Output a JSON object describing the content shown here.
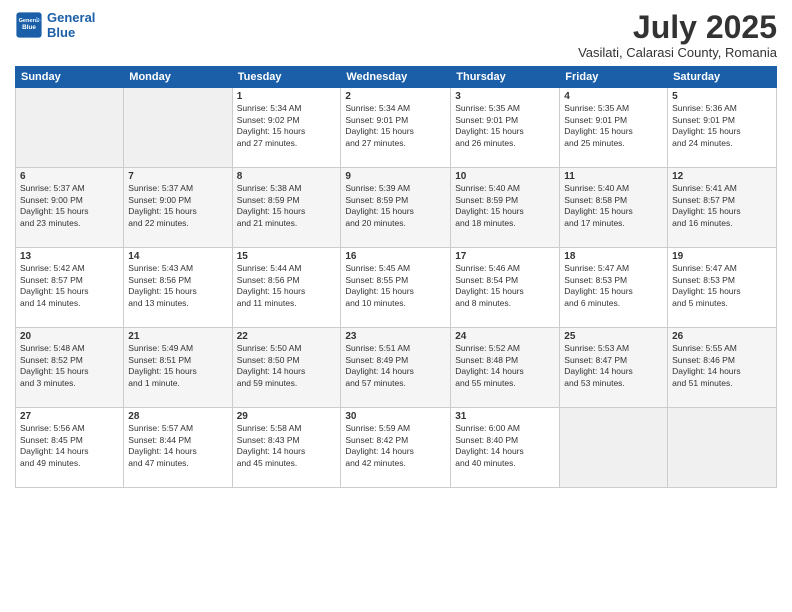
{
  "header": {
    "logo_line1": "General",
    "logo_line2": "Blue",
    "month_year": "July 2025",
    "location": "Vasilati, Calarasi County, Romania"
  },
  "weekdays": [
    "Sunday",
    "Monday",
    "Tuesday",
    "Wednesday",
    "Thursday",
    "Friday",
    "Saturday"
  ],
  "weeks": [
    [
      {
        "day": "",
        "info": ""
      },
      {
        "day": "",
        "info": ""
      },
      {
        "day": "1",
        "info": "Sunrise: 5:34 AM\nSunset: 9:02 PM\nDaylight: 15 hours\nand 27 minutes."
      },
      {
        "day": "2",
        "info": "Sunrise: 5:34 AM\nSunset: 9:01 PM\nDaylight: 15 hours\nand 27 minutes."
      },
      {
        "day": "3",
        "info": "Sunrise: 5:35 AM\nSunset: 9:01 PM\nDaylight: 15 hours\nand 26 minutes."
      },
      {
        "day": "4",
        "info": "Sunrise: 5:35 AM\nSunset: 9:01 PM\nDaylight: 15 hours\nand 25 minutes."
      },
      {
        "day": "5",
        "info": "Sunrise: 5:36 AM\nSunset: 9:01 PM\nDaylight: 15 hours\nand 24 minutes."
      }
    ],
    [
      {
        "day": "6",
        "info": "Sunrise: 5:37 AM\nSunset: 9:00 PM\nDaylight: 15 hours\nand 23 minutes."
      },
      {
        "day": "7",
        "info": "Sunrise: 5:37 AM\nSunset: 9:00 PM\nDaylight: 15 hours\nand 22 minutes."
      },
      {
        "day": "8",
        "info": "Sunrise: 5:38 AM\nSunset: 8:59 PM\nDaylight: 15 hours\nand 21 minutes."
      },
      {
        "day": "9",
        "info": "Sunrise: 5:39 AM\nSunset: 8:59 PM\nDaylight: 15 hours\nand 20 minutes."
      },
      {
        "day": "10",
        "info": "Sunrise: 5:40 AM\nSunset: 8:59 PM\nDaylight: 15 hours\nand 18 minutes."
      },
      {
        "day": "11",
        "info": "Sunrise: 5:40 AM\nSunset: 8:58 PM\nDaylight: 15 hours\nand 17 minutes."
      },
      {
        "day": "12",
        "info": "Sunrise: 5:41 AM\nSunset: 8:57 PM\nDaylight: 15 hours\nand 16 minutes."
      }
    ],
    [
      {
        "day": "13",
        "info": "Sunrise: 5:42 AM\nSunset: 8:57 PM\nDaylight: 15 hours\nand 14 minutes."
      },
      {
        "day": "14",
        "info": "Sunrise: 5:43 AM\nSunset: 8:56 PM\nDaylight: 15 hours\nand 13 minutes."
      },
      {
        "day": "15",
        "info": "Sunrise: 5:44 AM\nSunset: 8:56 PM\nDaylight: 15 hours\nand 11 minutes."
      },
      {
        "day": "16",
        "info": "Sunrise: 5:45 AM\nSunset: 8:55 PM\nDaylight: 15 hours\nand 10 minutes."
      },
      {
        "day": "17",
        "info": "Sunrise: 5:46 AM\nSunset: 8:54 PM\nDaylight: 15 hours\nand 8 minutes."
      },
      {
        "day": "18",
        "info": "Sunrise: 5:47 AM\nSunset: 8:53 PM\nDaylight: 15 hours\nand 6 minutes."
      },
      {
        "day": "19",
        "info": "Sunrise: 5:47 AM\nSunset: 8:53 PM\nDaylight: 15 hours\nand 5 minutes."
      }
    ],
    [
      {
        "day": "20",
        "info": "Sunrise: 5:48 AM\nSunset: 8:52 PM\nDaylight: 15 hours\nand 3 minutes."
      },
      {
        "day": "21",
        "info": "Sunrise: 5:49 AM\nSunset: 8:51 PM\nDaylight: 15 hours\nand 1 minute."
      },
      {
        "day": "22",
        "info": "Sunrise: 5:50 AM\nSunset: 8:50 PM\nDaylight: 14 hours\nand 59 minutes."
      },
      {
        "day": "23",
        "info": "Sunrise: 5:51 AM\nSunset: 8:49 PM\nDaylight: 14 hours\nand 57 minutes."
      },
      {
        "day": "24",
        "info": "Sunrise: 5:52 AM\nSunset: 8:48 PM\nDaylight: 14 hours\nand 55 minutes."
      },
      {
        "day": "25",
        "info": "Sunrise: 5:53 AM\nSunset: 8:47 PM\nDaylight: 14 hours\nand 53 minutes."
      },
      {
        "day": "26",
        "info": "Sunrise: 5:55 AM\nSunset: 8:46 PM\nDaylight: 14 hours\nand 51 minutes."
      }
    ],
    [
      {
        "day": "27",
        "info": "Sunrise: 5:56 AM\nSunset: 8:45 PM\nDaylight: 14 hours\nand 49 minutes."
      },
      {
        "day": "28",
        "info": "Sunrise: 5:57 AM\nSunset: 8:44 PM\nDaylight: 14 hours\nand 47 minutes."
      },
      {
        "day": "29",
        "info": "Sunrise: 5:58 AM\nSunset: 8:43 PM\nDaylight: 14 hours\nand 45 minutes."
      },
      {
        "day": "30",
        "info": "Sunrise: 5:59 AM\nSunset: 8:42 PM\nDaylight: 14 hours\nand 42 minutes."
      },
      {
        "day": "31",
        "info": "Sunrise: 6:00 AM\nSunset: 8:40 PM\nDaylight: 14 hours\nand 40 minutes."
      },
      {
        "day": "",
        "info": ""
      },
      {
        "day": "",
        "info": ""
      }
    ]
  ]
}
